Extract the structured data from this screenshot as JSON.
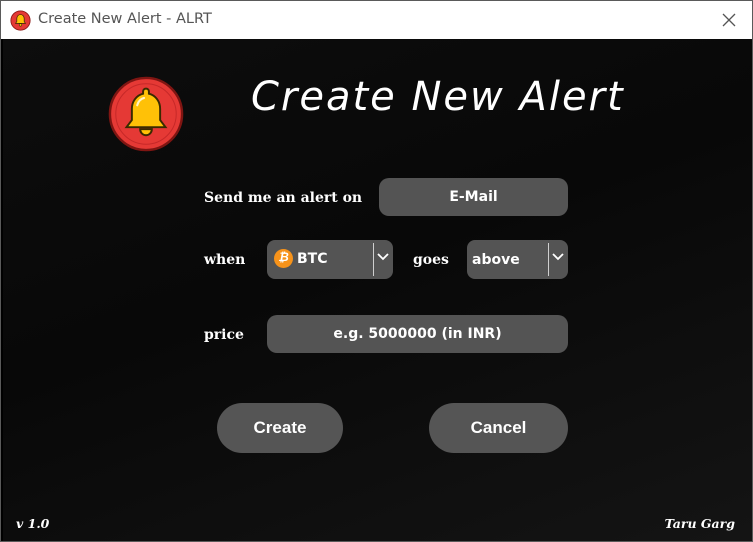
{
  "window": {
    "title": "Create New Alert - ALRT",
    "close_glyph": "✕",
    "icon": "bell-icon"
  },
  "header": {
    "heading": "Create New Alert",
    "logo_icon": "bell-icon",
    "logo_color": "#e53935",
    "bell_color": "#ffc107"
  },
  "form": {
    "channel_label": "Send me an alert on",
    "channel_value": "E-Mail",
    "when_label": "when",
    "coin_value": "BTC",
    "coin_icon": "bitcoin-icon",
    "coin_symbol": "₿",
    "goes_label": "goes",
    "direction_value": "above",
    "price_label": "price",
    "price_placeholder": "e.g. 5000000 (in INR)"
  },
  "actions": {
    "create_label": "Create",
    "cancel_label": "Cancel"
  },
  "footer": {
    "version": "v 1.0",
    "author": "Taru Garg"
  },
  "colors": {
    "background": "#0a0a0a",
    "field": "#545454",
    "text": "#ffffff"
  }
}
